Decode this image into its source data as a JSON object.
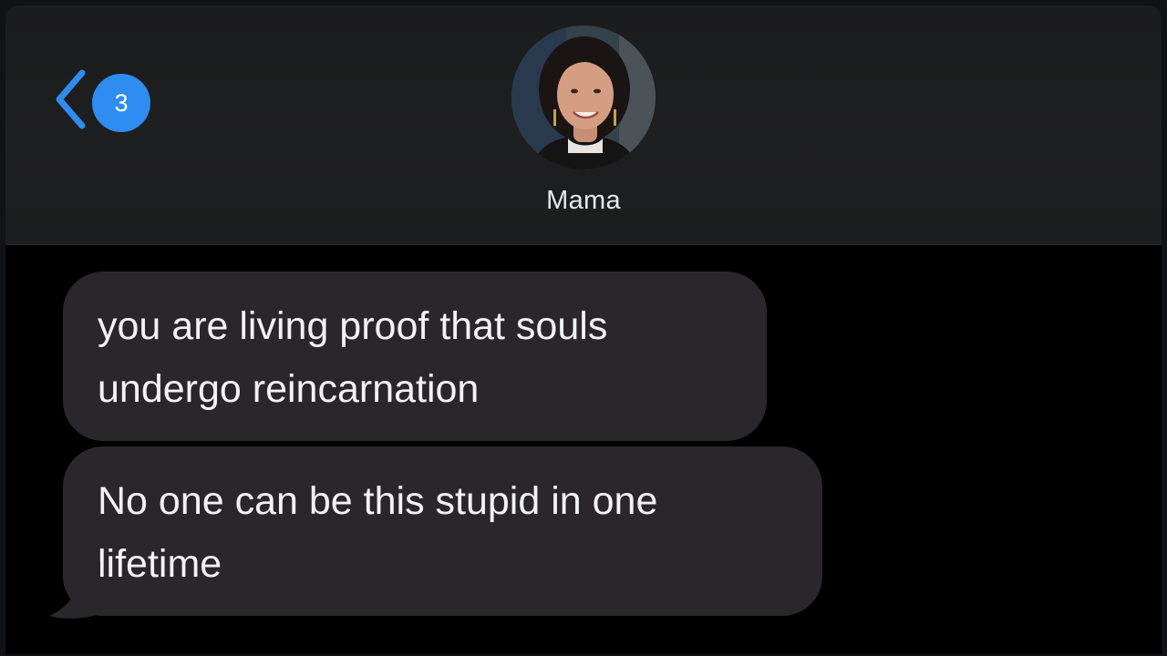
{
  "header": {
    "back_badge_count": "3",
    "contact_name": "Mama"
  },
  "messages": [
    {
      "direction": "incoming",
      "lines": [
        "you are living proof that souls",
        "undergo reincarnation"
      ]
    },
    {
      "direction": "incoming",
      "lines": [
        "No one can be this stupid in one",
        "lifetime"
      ]
    }
  ],
  "colors": {
    "accent": "#2f8cf0",
    "header_bg": "#1e1f20",
    "bubble_bg": "#2a272c",
    "screen_bg": "#000000",
    "text": "#f2f2f4"
  },
  "icons": {
    "back": "chevron-left-icon"
  }
}
